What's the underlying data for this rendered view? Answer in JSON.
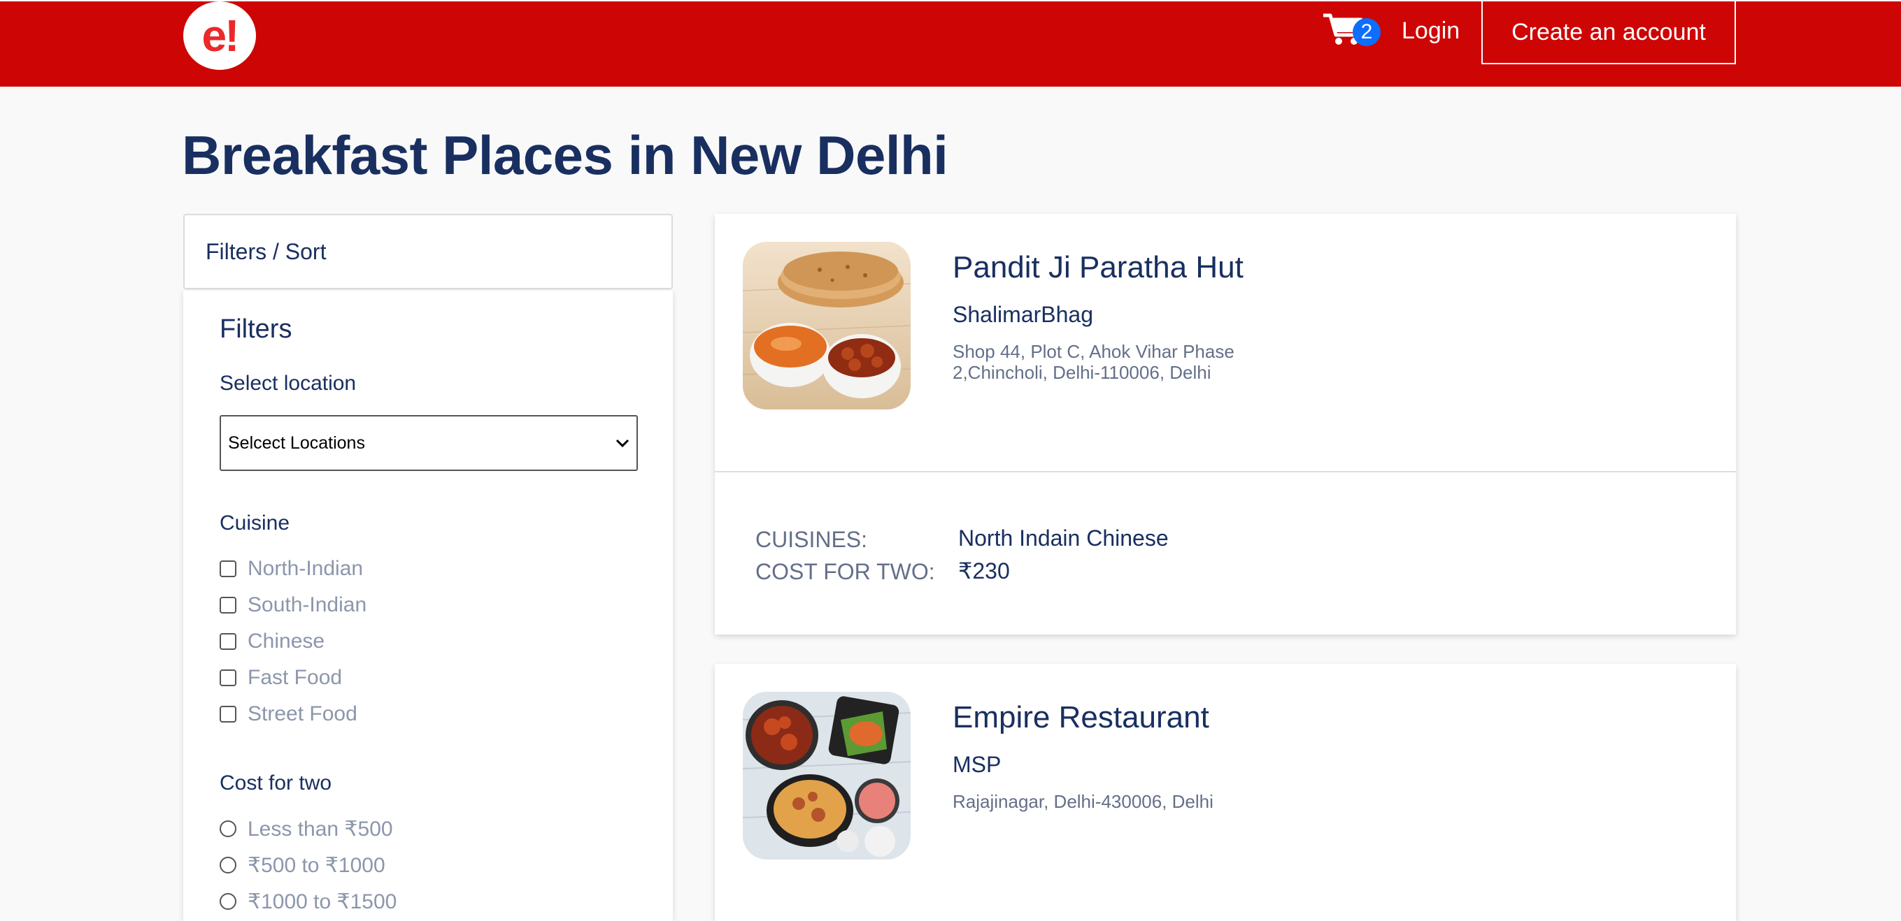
{
  "header": {
    "logo_text": "e!",
    "cart_count": "2",
    "login_label": "Login",
    "create_account_label": "Create an account"
  },
  "page_title": "Breakfast Places in New Delhi",
  "sidebar": {
    "header_label": "Filters / Sort",
    "filters_title": "Filters",
    "location_label": "Select location",
    "location_selected": "Selcect Locations",
    "cuisine_label": "Cuisine",
    "cuisines": [
      "North-Indian",
      "South-Indian",
      "Chinese",
      "Fast Food",
      "Street Food"
    ],
    "cost_label": "Cost for two",
    "cost_options": [
      "Less than ₹500",
      "₹500 to ₹1000",
      "₹1000 to ₹1500"
    ]
  },
  "restaurants": [
    {
      "name": "Pandit Ji Paratha Hut",
      "area": "ShalimarBhag",
      "address": "Shop 44, Plot C, Ahok Vihar Phase 2,Chincholi, Delhi-110006, Delhi",
      "cuisines_key": "CUISINES:",
      "cuisines_val": "North Indain Chinese",
      "cost_key": "COST FOR TWO:",
      "cost_val": "₹230"
    },
    {
      "name": "Empire Restaurant",
      "area": "MSP",
      "address": "Rajajinagar, Delhi-430006, Delhi"
    }
  ],
  "colors": {
    "brand_red": "#ce0505",
    "navy_text": "#192f60",
    "badge_blue": "#0d6efd"
  }
}
